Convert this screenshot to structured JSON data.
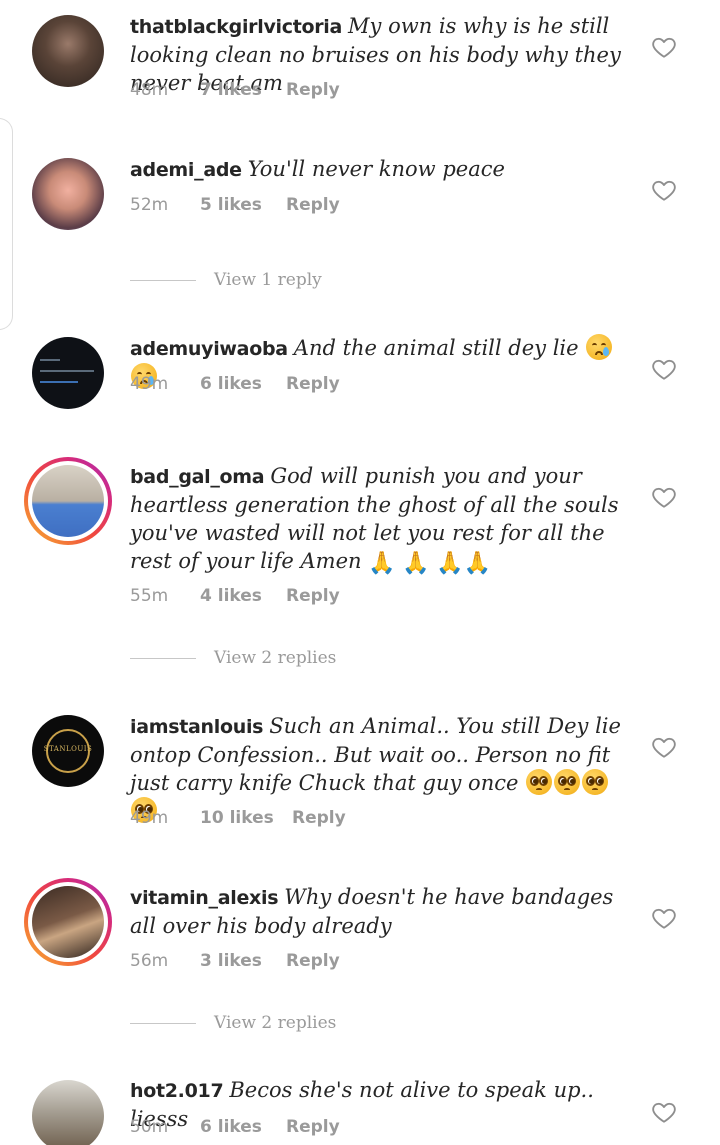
{
  "comments": [
    {
      "username": "thatblackgirlvictoria",
      "text": "My own is why is he still looking clean no bruises on his body why they never beat am",
      "time": "48m",
      "likes": "7 likes",
      "reply": "Reply"
    },
    {
      "username": "ademi_ade",
      "text": "You'll never know peace",
      "time": "52m",
      "likes": "5 likes",
      "reply": "Reply",
      "view_replies": "View 1 reply"
    },
    {
      "username": "ademuyiwaoba",
      "text": "And the animal still dey lie",
      "emojis": [
        "crying-face",
        "crying-face"
      ],
      "time": "49m",
      "likes": "6 likes",
      "reply": "Reply"
    },
    {
      "username": "bad_gal_oma",
      "text": "God will punish you and your heartless generation the ghost of all the souls you've wasted will not let you rest for all the rest of your life Amen",
      "emojis": [
        "folded-hands",
        "folded-hands",
        "folded-hands",
        "folded-hands"
      ],
      "time": "55m",
      "likes": "4 likes",
      "reply": "Reply",
      "view_replies": "View 2 replies",
      "story_ring": true
    },
    {
      "username": "iamstanlouis",
      "text": "Such an Animal.. You still Dey lie ontop Confession.. But wait oo.. Person no fit just carry knife Chuck that guy once",
      "emojis": [
        "pleading-face",
        "pleading-face",
        "pleading-face",
        "pleading-face"
      ],
      "time": "49m",
      "likes": "10 likes",
      "reply": "Reply",
      "avatar_logo_text": "STANLOUIS"
    },
    {
      "username": "vitamin_alexis",
      "text": "Why doesn't he have bandages all over his body already",
      "time": "56m",
      "likes": "3 likes",
      "reply": "Reply",
      "view_replies": "View 2 replies",
      "story_ring": true
    },
    {
      "username": "hot2.017",
      "text": "Becos she's not alive to speak up.. liesss",
      "time": "50m",
      "likes": "6 likes",
      "reply": "Reply"
    }
  ],
  "icons": {
    "like": "heart-outline-icon"
  },
  "colors": {
    "text": "#262626",
    "meta": "#9a9a9a",
    "ring_start": "#f7b231",
    "ring_end": "#a32cc0"
  }
}
